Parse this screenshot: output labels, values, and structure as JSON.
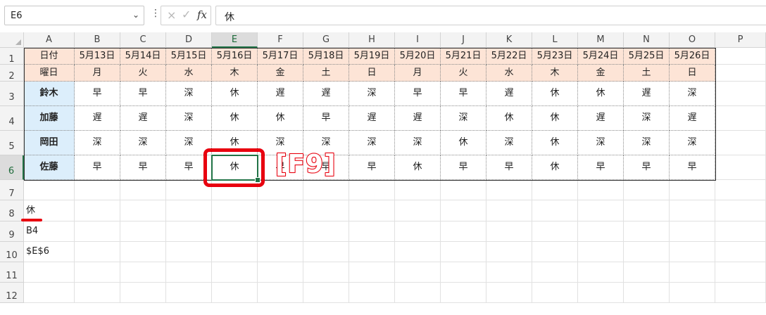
{
  "name_box": {
    "value": "E6"
  },
  "formula_bar": {
    "value": "休",
    "cancel_icon": "×",
    "enter_icon": "✓",
    "fx_label": "fx"
  },
  "columns": [
    "A",
    "B",
    "C",
    "D",
    "E",
    "F",
    "G",
    "H",
    "I",
    "J",
    "K",
    "L",
    "M",
    "N",
    "O",
    "P"
  ],
  "rows": [
    "1",
    "2",
    "3",
    "4",
    "5",
    "6",
    "7",
    "8",
    "9",
    "10",
    "11",
    "12"
  ],
  "active_cell": {
    "column": "E",
    "row": "6"
  },
  "table": {
    "date_label": "日付",
    "weekday_label": "曜日",
    "dates": [
      "5月13日",
      "5月14日",
      "5月15日",
      "5月16日",
      "5月17日",
      "5月18日",
      "5月19日",
      "5月20日",
      "5月21日",
      "5月22日",
      "5月23日",
      "5月24日",
      "5月25日",
      "5月26日"
    ],
    "weekdays": [
      "月",
      "火",
      "水",
      "木",
      "金",
      "土",
      "日",
      "月",
      "火",
      "水",
      "木",
      "金",
      "土",
      "日"
    ],
    "staff": [
      {
        "name": "鈴木",
        "shifts": [
          "早",
          "早",
          "深",
          "休",
          "遅",
          "遅",
          "深",
          "早",
          "早",
          "遅",
          "休",
          "休",
          "遅",
          "深"
        ]
      },
      {
        "name": "加藤",
        "shifts": [
          "遅",
          "遅",
          "深",
          "休",
          "休",
          "早",
          "遅",
          "遅",
          "深",
          "休",
          "休",
          "遅",
          "深",
          "遅"
        ]
      },
      {
        "name": "岡田",
        "shifts": [
          "深",
          "深",
          "深",
          "休",
          "深",
          "深",
          "深",
          "深",
          "休",
          "深",
          "休",
          "深",
          "深",
          "深"
        ]
      },
      {
        "name": "佐藤",
        "shifts": [
          "早",
          "早",
          "早",
          "休",
          "早",
          "早",
          "早",
          "休",
          "早",
          "早",
          "休",
          "早",
          "早",
          "早"
        ]
      }
    ]
  },
  "extra_cells": {
    "A8": "休",
    "A9": "B4",
    "A10": "$E$6"
  },
  "annotation": {
    "key_label": "[F9]"
  },
  "colors": {
    "accent": "#217346",
    "highlight": "#e8000f",
    "header_fill": "#fde4d6",
    "name_fill": "#dceefb"
  }
}
